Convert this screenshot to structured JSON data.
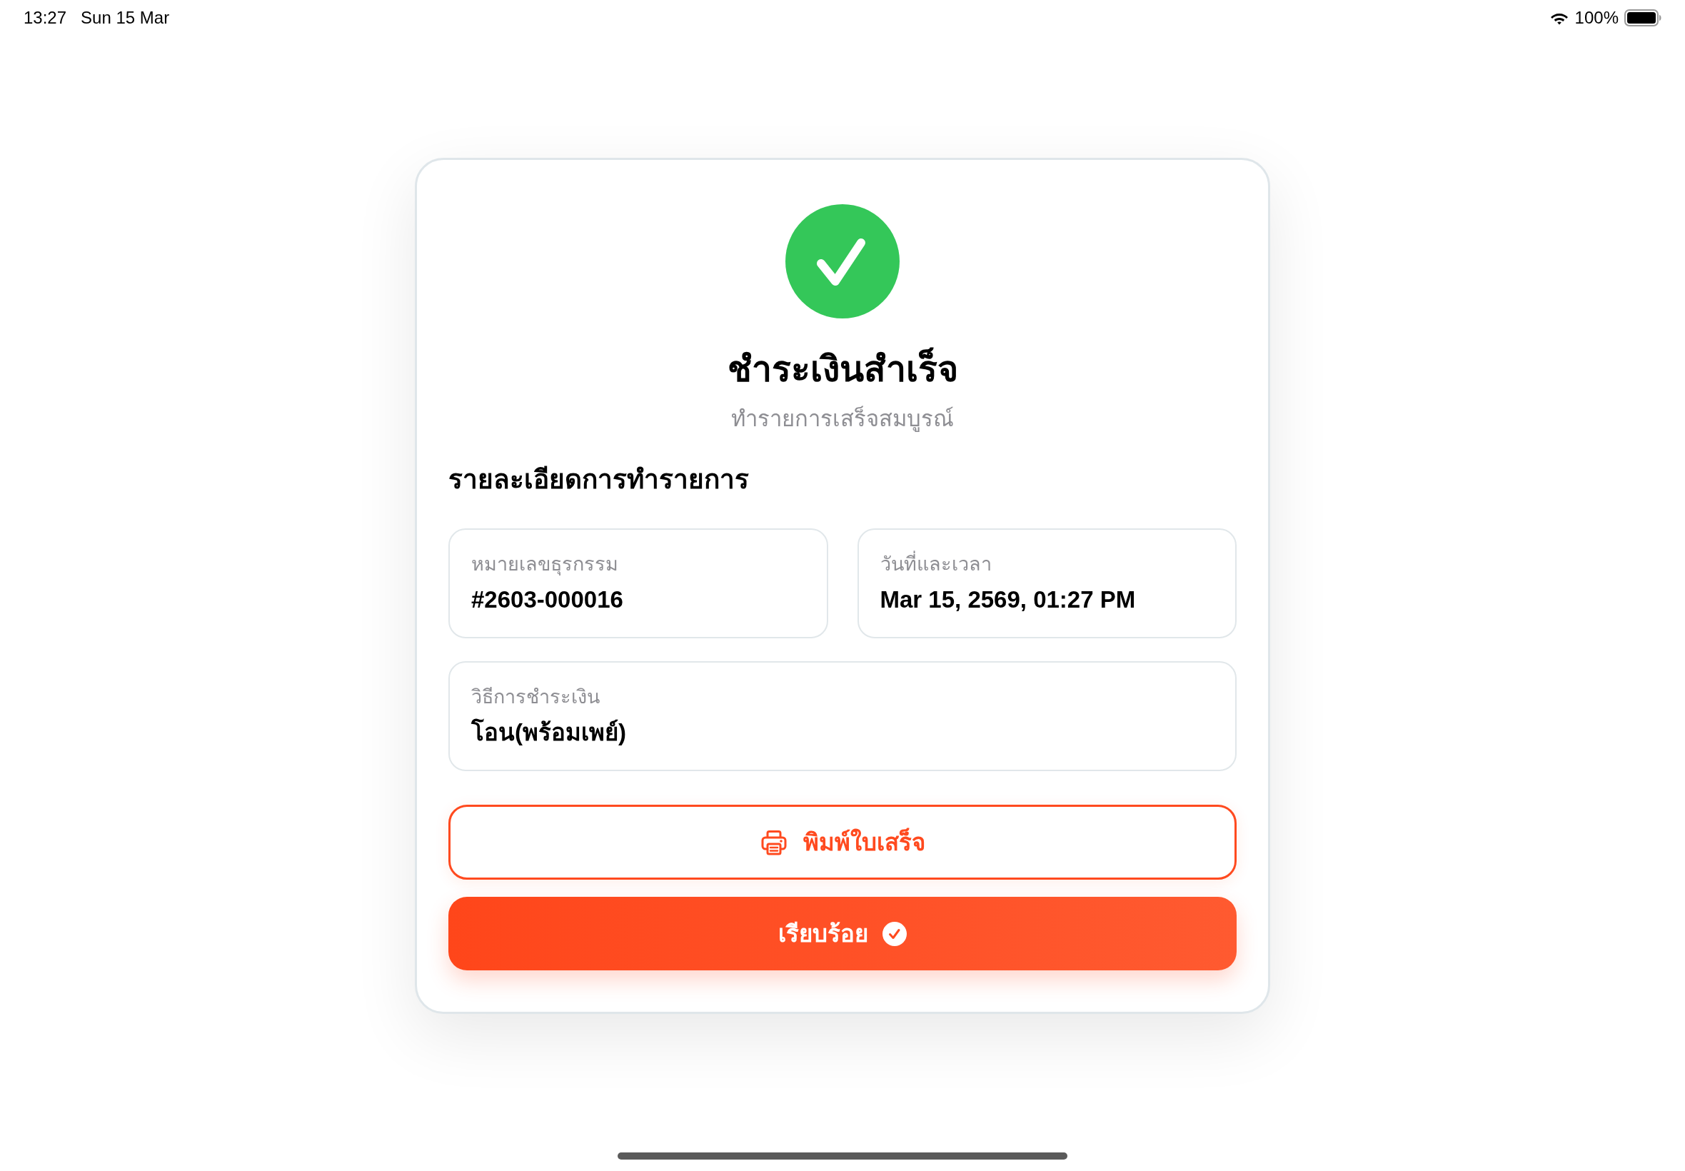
{
  "status_bar": {
    "time": "13:27",
    "date": "Sun 15 Mar",
    "battery": "100%"
  },
  "result": {
    "kind": "success",
    "title": "ชำระเงินสำเร็จ",
    "subtitle": "ทำรายการเสร็จสมบูรณ์"
  },
  "details": {
    "heading": "รายละเอียดการทำรายการ",
    "rows": [
      [
        {
          "label": "หมายเลขธุรกรรม",
          "value": "#2603-000016"
        },
        {
          "label": "วันที่และเวลา",
          "value": "Mar 15, 2569, 01:27 PM"
        }
      ],
      [
        {
          "label": "วิธีการชำระเงิน",
          "value": "โอน(พร้อมเพย์)"
        }
      ]
    ]
  },
  "buttons": [
    {
      "label": "พิมพ์ใบเสร็จ",
      "kind": "outline"
    },
    {
      "label": "เรียบร้อย",
      "kind": "primary"
    }
  ]
}
